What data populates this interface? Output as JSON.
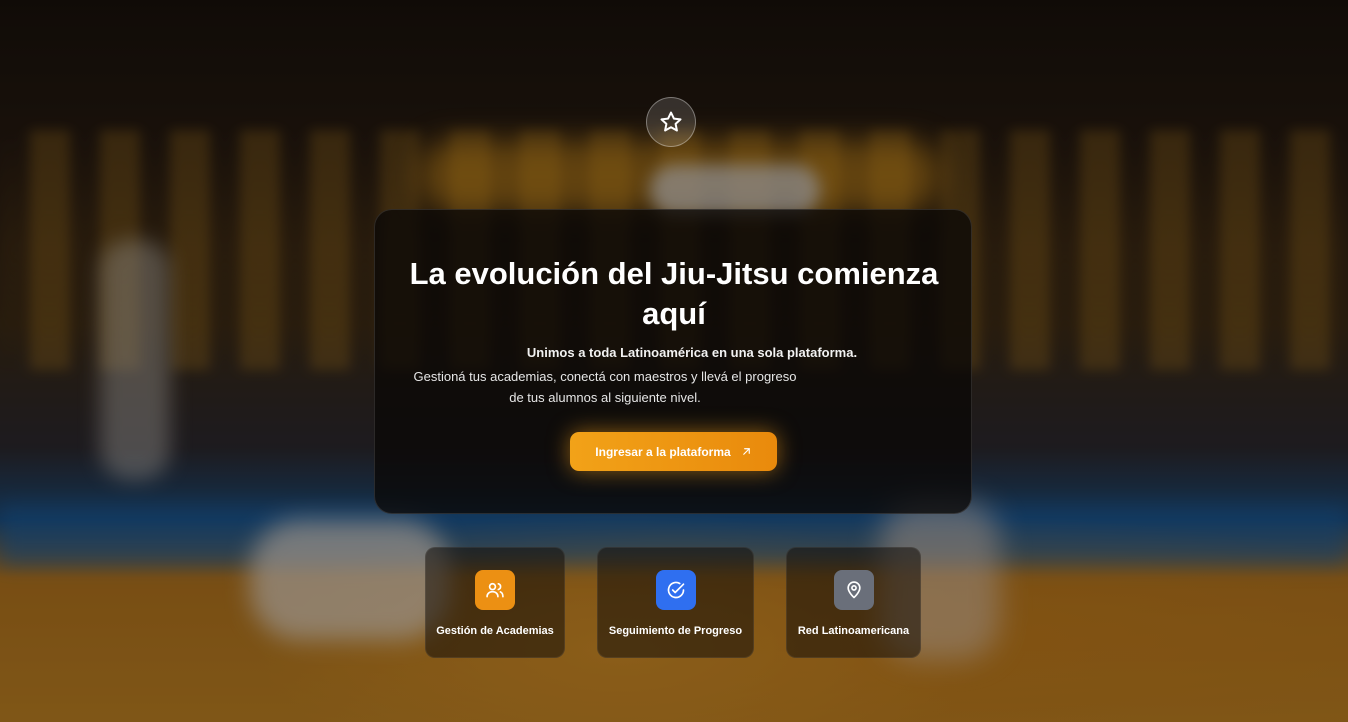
{
  "hero": {
    "title": "La evolución del Jiu-Jitsu comienza aquí",
    "subtitle": "Unimos a toda Latinoamérica en una sola plataforma.",
    "description": "Gestioná tus academias, conectá con maestros y llevá el progreso de tus alumnos al siguiente nivel.",
    "cta_label": "Ingresar a la plataforma",
    "cta_icon": "arrow-up-right-icon",
    "badge_icon": "star-icon"
  },
  "features": [
    {
      "label": "Gestión de Academias",
      "icon": "users-icon",
      "color": "#ec9013"
    },
    {
      "label": "Seguimiento de Progreso",
      "icon": "check-circle-icon",
      "color": "#2f6ff0"
    },
    {
      "label": "Red Latinoamericana",
      "icon": "map-pin-icon",
      "color": "#6a6f7a"
    }
  ],
  "colors": {
    "accent": "#ec9013",
    "card_background": "rgba(10,8,6,0.78)"
  }
}
